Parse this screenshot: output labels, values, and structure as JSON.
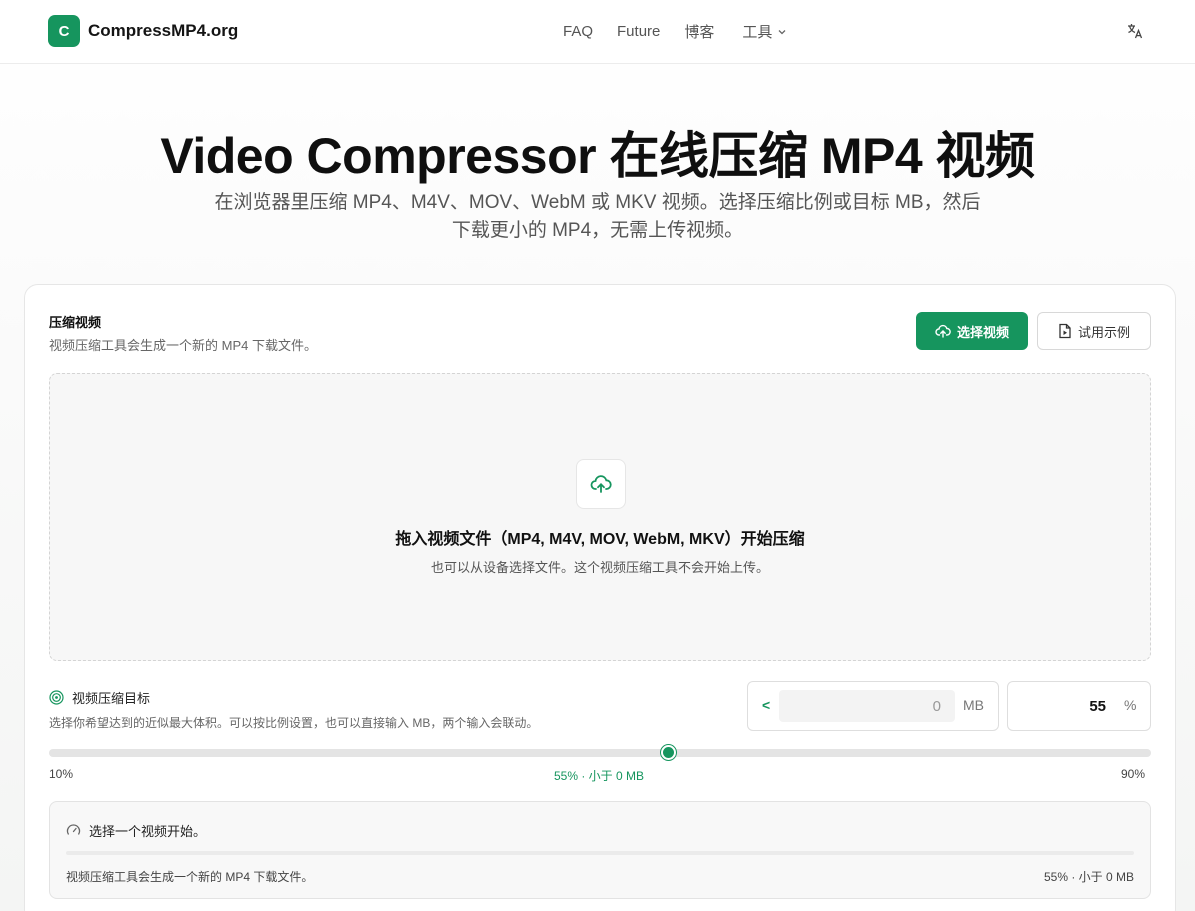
{
  "header": {
    "logo_letter": "C",
    "site_name": "CompressMP4.org",
    "nav": [
      "FAQ",
      "Future",
      "博客",
      "工具"
    ],
    "language_icon": "translate-icon"
  },
  "hero": {
    "title": "Video Compressor 在线压缩 MP4 视频",
    "subtitle": "在浏览器里压缩 MP4、M4V、MOV、WebM 或 MKV 视频。选择压缩比例或目标 MB，然后下载更小的 MP4，无需上传视频。"
  },
  "card": {
    "title": "压缩视频",
    "description": "视频压缩工具会生成一个新的 MP4 下载文件。",
    "primary_button": "选择视频",
    "secondary_button": "试用示例"
  },
  "dropzone": {
    "title": "拖入视频文件（MP4, M4V, MOV, WebM, MKV）开始压缩",
    "subtitle": "也可以从设备选择文件。这个视频压缩工具不会开始上传。"
  },
  "target": {
    "label": "视频压缩目标",
    "description": "选择你希望达到的近似最大体积。可以按比例设置，也可以直接输入 MB，两个输入会联动。",
    "mb_prefix": "<",
    "mb_value": "0",
    "mb_unit": "MB",
    "percent_value": "55",
    "percent_unit": "%",
    "slider_min": "10%",
    "slider_mid": "55% · 小于 0 MB",
    "slider_max": "90%",
    "slider_level": 0.5625
  },
  "status": {
    "message": "选择一个视频开始。",
    "footer": "视频压缩工具会生成一个新的 MP4 下载文件。",
    "summary": "55% · 小于 0 MB"
  },
  "colors": {
    "accent": "#16955e"
  }
}
